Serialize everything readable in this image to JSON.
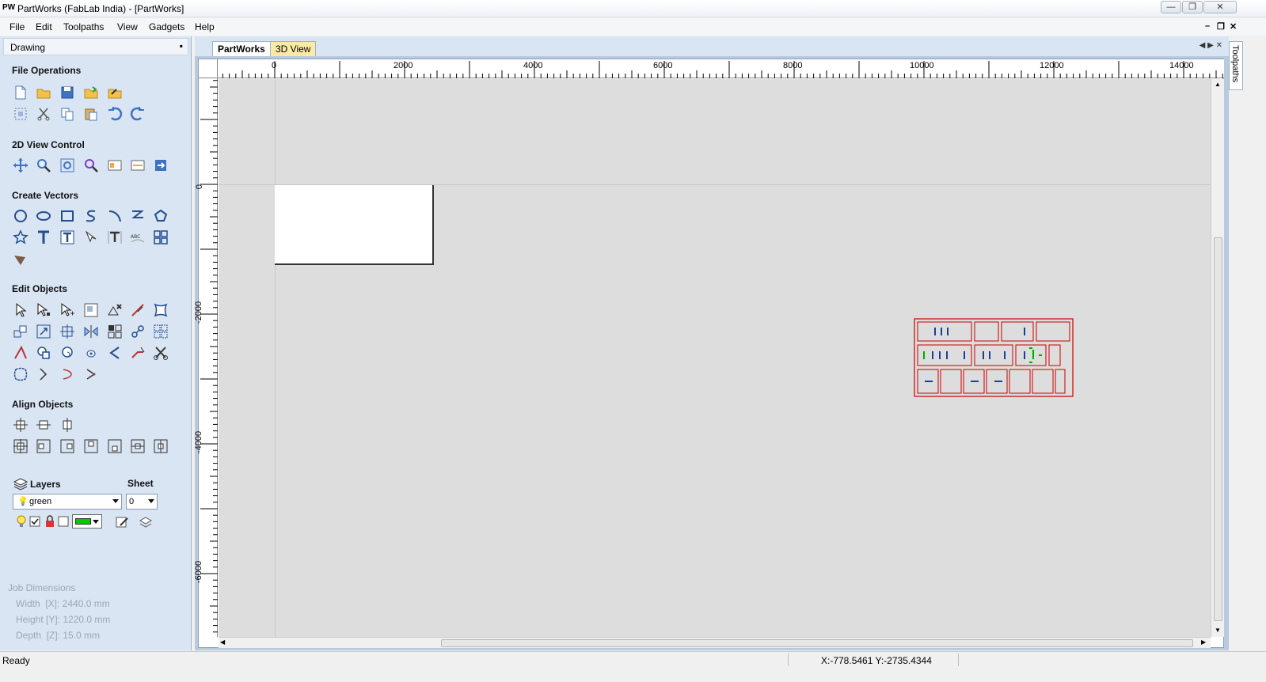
{
  "app": {
    "logo": "PW",
    "title": "PartWorks (FabLab India) - [PartWorks]"
  },
  "window_controls": {
    "minimize": "—",
    "restore": "❐",
    "close": "✕"
  },
  "menu": [
    "File",
    "Edit",
    "Toolpaths",
    "View",
    "Gadgets",
    "Help"
  ],
  "mdi_controls": {
    "minimize": "–",
    "restore": "❐",
    "close": "✕"
  },
  "panel": {
    "title": "Drawing",
    "pin": "📌",
    "sections": {
      "file_operations": "File Operations",
      "view_control": "2D View Control",
      "create_vectors": "Create Vectors",
      "edit_objects": "Edit Objects",
      "align_objects": "Align Objects"
    },
    "layers": {
      "label": "Layers",
      "sheet_label": "Sheet",
      "selected_layer": "green",
      "selected_sheet": "0",
      "layer_color": "#00cc00"
    },
    "job_dimensions": {
      "heading": "Job Dimensions",
      "width": "Width  [X]: 2440.0 mm",
      "height": "Height [Y]: 1220.0 mm",
      "depth": "Depth  [Z]: 15.0 mm"
    }
  },
  "tabs": [
    {
      "label": "PartWorks",
      "active": true
    },
    {
      "label": "3D View",
      "active": false
    }
  ],
  "tab_nav": "◀ ▶ ✕",
  "rulers": {
    "horizontal": [
      "0",
      "2000",
      "4000",
      "6000",
      "8000",
      "10000",
      "12000",
      "14000"
    ],
    "vertical": [
      "0",
      "-2000",
      "-4000",
      "-6000"
    ]
  },
  "right_panel": {
    "label": "Toolpaths"
  },
  "status": {
    "text": "Ready",
    "coords": "X:-778.5461 Y:-2735.4344"
  },
  "colors": {
    "panel_bg": "#dae5f3",
    "canvas_bg": "#dddddd",
    "part_outline": "#cc0000",
    "slot_blue": "#1c3f94",
    "slot_green": "#00aa00"
  }
}
